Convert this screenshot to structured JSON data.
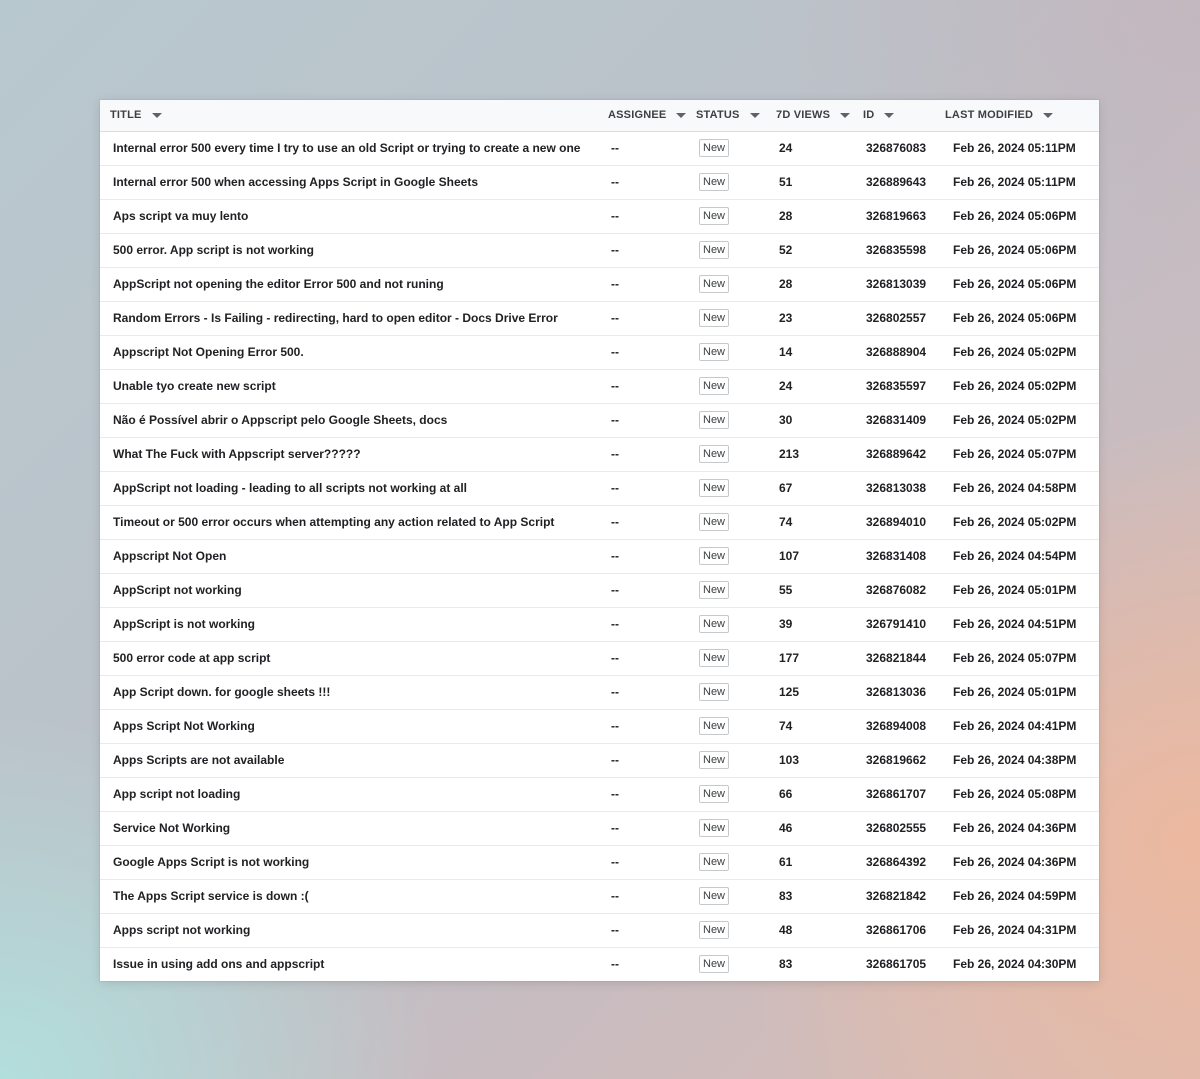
{
  "columns": {
    "title": "TITLE",
    "assignee": "ASSIGNEE",
    "status": "STATUS",
    "views": "7D VIEWS",
    "id": "ID",
    "modified": "LAST MODIFIED"
  },
  "rows": [
    {
      "title": "Internal error 500 every time I try to use an old Script or trying to create a new one",
      "assignee": "--",
      "status": "New",
      "views": "24",
      "id": "326876083",
      "modified": "Feb 26, 2024 05:11PM"
    },
    {
      "title": "Internal error 500 when accessing Apps Script in Google Sheets",
      "assignee": "--",
      "status": "New",
      "views": "51",
      "id": "326889643",
      "modified": "Feb 26, 2024 05:11PM"
    },
    {
      "title": "Aps script va muy lento",
      "assignee": "--",
      "status": "New",
      "views": "28",
      "id": "326819663",
      "modified": "Feb 26, 2024 05:06PM"
    },
    {
      "title": "500 error. App script is not working",
      "assignee": "--",
      "status": "New",
      "views": "52",
      "id": "326835598",
      "modified": "Feb 26, 2024 05:06PM"
    },
    {
      "title": "AppScript not opening the editor Error 500 and not runing",
      "assignee": "--",
      "status": "New",
      "views": "28",
      "id": "326813039",
      "modified": "Feb 26, 2024 05:06PM"
    },
    {
      "title": "Random Errors - Is Failing - redirecting, hard to open editor - Docs Drive Error",
      "assignee": "--",
      "status": "New",
      "views": "23",
      "id": "326802557",
      "modified": "Feb 26, 2024 05:06PM"
    },
    {
      "title": "Appscript Not Opening Error 500.",
      "assignee": "--",
      "status": "New",
      "views": "14",
      "id": "326888904",
      "modified": "Feb 26, 2024 05:02PM"
    },
    {
      "title": "Unable tyo create new script",
      "assignee": "--",
      "status": "New",
      "views": "24",
      "id": "326835597",
      "modified": "Feb 26, 2024 05:02PM"
    },
    {
      "title": "Não é Possível abrir o Appscript pelo Google Sheets, docs",
      "assignee": "--",
      "status": "New",
      "views": "30",
      "id": "326831409",
      "modified": "Feb 26, 2024 05:02PM"
    },
    {
      "title": "What The Fuck with Appscript server?????",
      "assignee": "--",
      "status": "New",
      "views": "213",
      "id": "326889642",
      "modified": "Feb 26, 2024 05:07PM"
    },
    {
      "title": "AppScript not loading - leading to all scripts not working at all",
      "assignee": "--",
      "status": "New",
      "views": "67",
      "id": "326813038",
      "modified": "Feb 26, 2024 04:58PM"
    },
    {
      "title": "Timeout or 500 error occurs when attempting any action related to App Script",
      "assignee": "--",
      "status": "New",
      "views": "74",
      "id": "326894010",
      "modified": "Feb 26, 2024 05:02PM"
    },
    {
      "title": "Appscript Not Open",
      "assignee": "--",
      "status": "New",
      "views": "107",
      "id": "326831408",
      "modified": "Feb 26, 2024 04:54PM"
    },
    {
      "title": "AppScript not working",
      "assignee": "--",
      "status": "New",
      "views": "55",
      "id": "326876082",
      "modified": "Feb 26, 2024 05:01PM"
    },
    {
      "title": "AppScript is not working",
      "assignee": "--",
      "status": "New",
      "views": "39",
      "id": "326791410",
      "modified": "Feb 26, 2024 04:51PM"
    },
    {
      "title": "500 error code at app script",
      "assignee": "--",
      "status": "New",
      "views": "177",
      "id": "326821844",
      "modified": "Feb 26, 2024 05:07PM"
    },
    {
      "title": "App Script down. for google sheets !!!",
      "assignee": "--",
      "status": "New",
      "views": "125",
      "id": "326813036",
      "modified": "Feb 26, 2024 05:01PM"
    },
    {
      "title": "Apps Script Not Working",
      "assignee": "--",
      "status": "New",
      "views": "74",
      "id": "326894008",
      "modified": "Feb 26, 2024 04:41PM"
    },
    {
      "title": "Apps Scripts are not available",
      "assignee": "--",
      "status": "New",
      "views": "103",
      "id": "326819662",
      "modified": "Feb 26, 2024 04:38PM"
    },
    {
      "title": "App script not loading",
      "assignee": "--",
      "status": "New",
      "views": "66",
      "id": "326861707",
      "modified": "Feb 26, 2024 05:08PM"
    },
    {
      "title": "Service Not Working",
      "assignee": "--",
      "status": "New",
      "views": "46",
      "id": "326802555",
      "modified": "Feb 26, 2024 04:36PM"
    },
    {
      "title": "Google Apps Script is not working",
      "assignee": "--",
      "status": "New",
      "views": "61",
      "id": "326864392",
      "modified": "Feb 26, 2024 04:36PM"
    },
    {
      "title": "The Apps Script service is down :(",
      "assignee": "--",
      "status": "New",
      "views": "83",
      "id": "326821842",
      "modified": "Feb 26, 2024 04:59PM"
    },
    {
      "title": "Apps script not working",
      "assignee": "--",
      "status": "New",
      "views": "48",
      "id": "326861706",
      "modified": "Feb 26, 2024 04:31PM"
    },
    {
      "title": "Issue in using add ons and appscript",
      "assignee": "--",
      "status": "New",
      "views": "83",
      "id": "326861705",
      "modified": "Feb 26, 2024 04:30PM"
    }
  ]
}
